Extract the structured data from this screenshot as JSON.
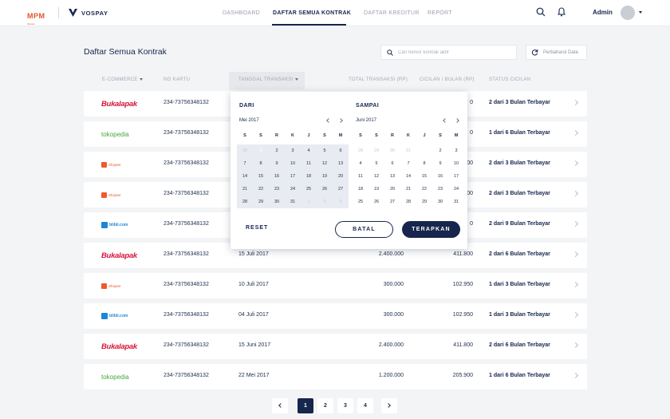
{
  "brand": {
    "mpm": "MPM",
    "mpm_sub": "finance",
    "vospay": "VOSPAY"
  },
  "nav": {
    "items": [
      "DASHBOARD",
      "DAFTAR SEMUA KONTRAK",
      "DAFTAR KREDITUR",
      "REPORT"
    ],
    "active": "DAFTAR SEMUA KONTRAK"
  },
  "user": {
    "name": "Admin"
  },
  "page": {
    "title": "Daftar Semua Kontrak"
  },
  "search": {
    "placeholder": "Cari nomor kontrak aktif"
  },
  "refresh": {
    "label": "Perbaharui Data"
  },
  "table": {
    "headers": [
      "E-COMMERCE",
      "NO KARTU",
      "TANGGAL TRANSAKSI",
      "TOTAL TRANSAKSI (RP)",
      "CICILAN / BULAN (RP)",
      "STATUS CICILAN"
    ],
    "rows": [
      {
        "brand": "Bukalapak",
        "brand_type": "bukalapak",
        "card": "234-73756348132",
        "date": "",
        "total": "",
        "cicilan": "0",
        "status": "2 dari 3 Bulan Terbayar"
      },
      {
        "brand": "tokopedia",
        "brand_type": "tokopedia",
        "card": "234-73756348132",
        "date": "",
        "total": "",
        "cicilan": "0",
        "status": "1 dari 6 Bulan Terbayar"
      },
      {
        "brand": "Shopee",
        "brand_type": "shopee",
        "card": "234-73756348132",
        "date": "",
        "total": "",
        "cicilan": "00",
        "status": "2 dari 3 Bulan Terbayar"
      },
      {
        "brand": "Shopee",
        "brand_type": "shopee",
        "card": "234-73756348132",
        "date": "",
        "total": "",
        "cicilan": "00",
        "status": "2 dari 3 Bulan Terbayar"
      },
      {
        "brand": "blibli.com",
        "brand_type": "blibli",
        "card": "234-73756348132",
        "date": "",
        "total": "",
        "cicilan": "0",
        "status": "2 dari 9 Bulan Terbayar"
      },
      {
        "brand": "Bukalapak",
        "brand_type": "bukalapak",
        "card": "234-73756348132",
        "date": "15 Juli 2017",
        "total": "2.400.000",
        "cicilan": "411.800",
        "status": "2 dari 6 Bulan Terbayar"
      },
      {
        "brand": "Shopee",
        "brand_type": "shopee",
        "card": "234-73756348132",
        "date": "10 Juli 2017",
        "total": "300.000",
        "cicilan": "102.950",
        "status": "1 dari 3 Bulan Terbayar"
      },
      {
        "brand": "blibli.com",
        "brand_type": "blibli",
        "card": "234-73756348132",
        "date": "04 Juli 2017",
        "total": "300.000",
        "cicilan": "102.950",
        "status": "1 dari 3 Bulan Terbayar"
      },
      {
        "brand": "Bukalapak",
        "brand_type": "bukalapak",
        "card": "234-73756348132",
        "date": "15 Juni 2017",
        "total": "2.400.000",
        "cicilan": "411.800",
        "status": "2 dari 6 Bulan Terbayar"
      },
      {
        "brand": "tokopedia",
        "brand_type": "tokopedia",
        "card": "234-73756348132",
        "date": "22 Mei 2017",
        "total": "1.200.000",
        "cicilan": "205.900",
        "status": "1 dari 6 Bulan Terbayar"
      }
    ]
  },
  "datepicker": {
    "from": {
      "heading": "DARI",
      "month": "Mei 2017",
      "weekdays": [
        "S",
        "S",
        "R",
        "K",
        "J",
        "S",
        "M"
      ],
      "days": [
        [
          "30",
          "1",
          "2",
          "3",
          "4",
          "5",
          "6"
        ],
        [
          "7",
          "8",
          "9",
          "10",
          "11",
          "12",
          "13"
        ],
        [
          "14",
          "15",
          "16",
          "17",
          "18",
          "19",
          "20"
        ],
        [
          "21",
          "22",
          "23",
          "24",
          "25",
          "26",
          "27"
        ],
        [
          "28",
          "29",
          "30",
          "31",
          "1",
          "2",
          "3"
        ]
      ],
      "selected": "1"
    },
    "to": {
      "heading": "SAMPAI",
      "month": "Juni 2017",
      "weekdays": [
        "S",
        "S",
        "R",
        "K",
        "J",
        "S",
        "M"
      ],
      "days": [
        [
          "28",
          "29",
          "30",
          "31",
          "1",
          "2",
          "3"
        ],
        [
          "4",
          "5",
          "6",
          "7",
          "8",
          "9",
          "10"
        ],
        [
          "11",
          "12",
          "13",
          "14",
          "15",
          "16",
          "17"
        ],
        [
          "18",
          "19",
          "20",
          "21",
          "22",
          "23",
          "24"
        ],
        [
          "25",
          "26",
          "27",
          "28",
          "29",
          "30",
          "31"
        ]
      ],
      "selected": "1"
    },
    "reset_label": "RESET",
    "cancel_label": "BATAL",
    "apply_label": "TERAPKAN"
  },
  "pagination": {
    "pages": [
      "1",
      "2",
      "3",
      "4"
    ],
    "current": "1"
  },
  "colors": {
    "primary": "#16264d",
    "bukalapak": "#d6153b",
    "tokopedia": "#42a842",
    "shopee": "#ee5a2b",
    "blibli": "#1b86d8"
  },
  "icons": [
    "search-icon",
    "bell-icon",
    "refresh-icon",
    "chevron-right-icon",
    "chevron-left-icon",
    "caret-down-icon"
  ]
}
